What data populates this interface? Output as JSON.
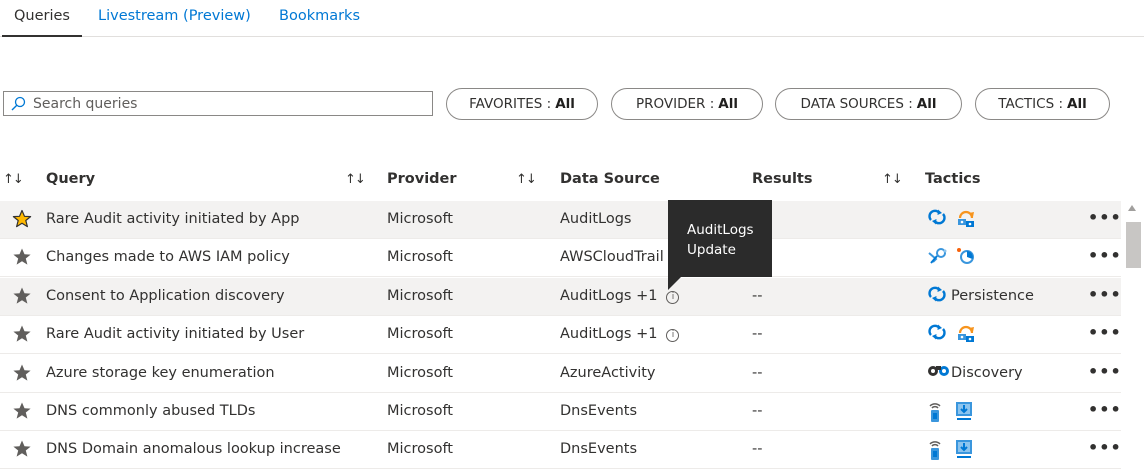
{
  "tabs": [
    {
      "label": "Queries"
    },
    {
      "label": "Livestream (Preview)"
    },
    {
      "label": "Bookmarks"
    }
  ],
  "search": {
    "placeholder": "Search queries",
    "value": ""
  },
  "filters": [
    {
      "name": "FAVORITES",
      "value": "All"
    },
    {
      "name": "PROVIDER",
      "value": "All"
    },
    {
      "name": "DATA SOURCES",
      "value": "All"
    },
    {
      "name": "TACTICS",
      "value": "All"
    }
  ],
  "columns": {
    "sort_glyph": "↑↓",
    "query": "Query",
    "provider": "Provider",
    "data_source": "Data Source",
    "results": "Results",
    "tactics": "Tactics"
  },
  "rows": [
    {
      "favorite": true,
      "query": "Rare Audit activity initiated by App",
      "provider": "Microsoft",
      "data_source": "AuditLogs",
      "info": false,
      "results": "",
      "tactic_icons": [
        "persistence-icon",
        "privilege-escalation-icon"
      ],
      "tactic_text": "",
      "more": "•••"
    },
    {
      "favorite": false,
      "query": "Changes made to AWS IAM policy",
      "provider": "Microsoft",
      "data_source": "AWSCloudTrail",
      "info": false,
      "results": "",
      "tactic_icons": [
        "credential-access-icon",
        "defense-evasion-icon"
      ],
      "tactic_text": "",
      "more": "•••"
    },
    {
      "favorite": false,
      "query": "Consent to Application discovery",
      "provider": "Microsoft",
      "data_source": "AuditLogs +1",
      "info": true,
      "results": "--",
      "tactic_icons": [
        "persistence-icon"
      ],
      "tactic_text": "Persistence",
      "more": "•••"
    },
    {
      "favorite": false,
      "query": "Rare Audit activity initiated by User",
      "provider": "Microsoft",
      "data_source": "AuditLogs +1",
      "info": true,
      "results": "--",
      "tactic_icons": [
        "persistence-icon",
        "privilege-escalation-icon"
      ],
      "tactic_text": "",
      "more": "•••"
    },
    {
      "favorite": false,
      "query": "Azure storage key enumeration",
      "provider": "Microsoft",
      "data_source": "AzureActivity",
      "info": false,
      "results": "--",
      "tactic_icons": [
        "discovery-icon"
      ],
      "tactic_text": "Discovery",
      "more": "•••"
    },
    {
      "favorite": false,
      "query": "DNS commonly abused TLDs",
      "provider": "Microsoft",
      "data_source": "DnsEvents",
      "info": false,
      "results": "--",
      "tactic_icons": [
        "command-and-control-icon",
        "exfiltration-icon"
      ],
      "tactic_text": "",
      "more": "•••"
    },
    {
      "favorite": false,
      "query": "DNS Domain anomalous lookup increase",
      "provider": "Microsoft",
      "data_source": "DnsEvents",
      "info": false,
      "results": "--",
      "tactic_icons": [
        "command-and-control-icon",
        "exfiltration-icon"
      ],
      "tactic_text": "",
      "more": "•••"
    }
  ],
  "tooltip": {
    "line1": "AuditLogs",
    "line2": "Update"
  },
  "colors": {
    "accent": "#0078d4",
    "favorite_star": "#ffb900",
    "star": "#605e5c"
  }
}
